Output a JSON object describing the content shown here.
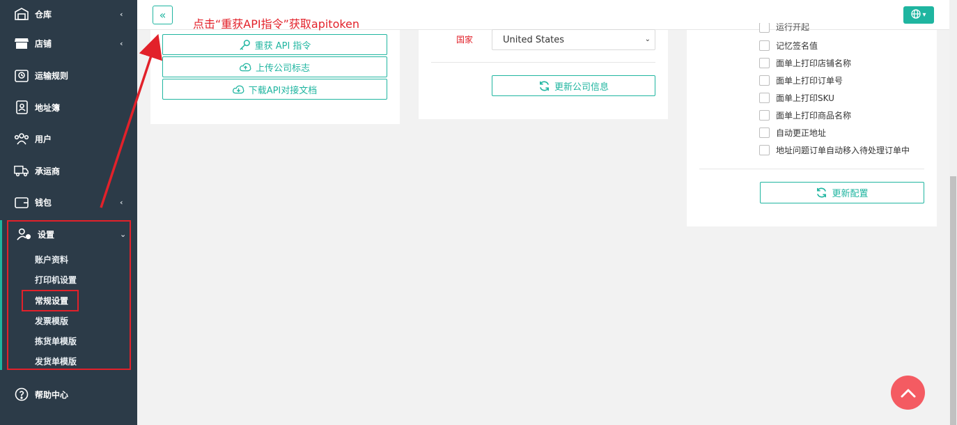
{
  "sidebar": {
    "items": [
      {
        "label": "仓库",
        "icon": "warehouse-icon",
        "chevron": "‹"
      },
      {
        "label": "店铺",
        "icon": "store-icon",
        "chevron": "‹"
      },
      {
        "label": "运输规则",
        "icon": "shipping-rule-icon",
        "chevron": ""
      },
      {
        "label": "地址簿",
        "icon": "address-book-icon",
        "chevron": ""
      },
      {
        "label": "用户",
        "icon": "users-icon",
        "chevron": ""
      },
      {
        "label": "承运商",
        "icon": "truck-icon",
        "chevron": ""
      },
      {
        "label": "钱包",
        "icon": "wallet-icon",
        "chevron": "‹"
      }
    ],
    "settings": {
      "label": "设置",
      "icon": "user-gear-icon",
      "chevron": "⌄"
    },
    "sub_items": [
      "账户资料",
      "打印机设置",
      "常规设置",
      "发票模版",
      "拣货单模版",
      "发货单模版"
    ],
    "help": {
      "label": "帮助中心",
      "icon": "help-circle-icon"
    }
  },
  "topbar": {
    "collapse_label": "«",
    "annotation": "点击“重获API指令”获取apitoken",
    "lang_label": "▾"
  },
  "card1": {
    "buttons": [
      "重获 API 指令",
      "上传公司标志",
      "下载API对接文档"
    ]
  },
  "card2": {
    "country_label": "国家",
    "country_value": "United States",
    "update_button": "更新公司信息"
  },
  "card3": {
    "partial_top": "运行开起",
    "checkboxes": [
      "记忆签名值",
      "面单上打印店铺名称",
      "面单上打印订单号",
      "面单上打印SKU",
      "面单上打印商品名称",
      "自动更正地址",
      "地址问题订单自动移入待处理订单中"
    ],
    "update_button": "更新配置"
  },
  "colors": {
    "accent": "#1fb5a0",
    "sidebar": "#2c3b48",
    "annotation": "#e2212a"
  }
}
